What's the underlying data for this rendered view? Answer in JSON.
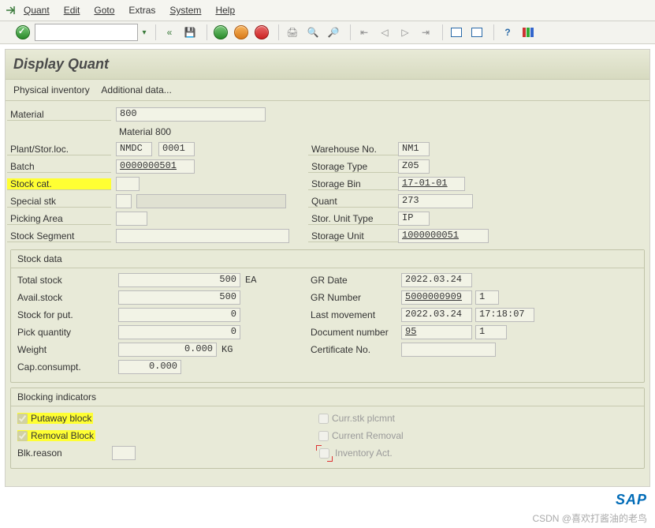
{
  "menu": {
    "quant": "Quant",
    "edit": "Edit",
    "goto": "Goto",
    "extras": "Extras",
    "system": "System",
    "help": "Help"
  },
  "title": "Display Quant",
  "subtoolbar": {
    "phys": "Physical inventory",
    "addl": "Additional data..."
  },
  "header": {
    "material_lbl": "Material",
    "material": "800",
    "material_desc": "Material 800",
    "plant_lbl": "Plant/Stor.loc.",
    "plant": "NMDC",
    "sloc": "0001",
    "batch_lbl": "Batch",
    "batch": "0000000501",
    "stockcat_lbl": "Stock cat.",
    "stockcat": "",
    "special_lbl": "Special stk",
    "special": "",
    "special2": "",
    "pick_lbl": "Picking Area",
    "pick": "",
    "seg_lbl": "Stock Segment",
    "seg": "",
    "whs_lbl": "Warehouse No.",
    "whs": "NM1",
    "styp_lbl": "Storage Type",
    "styp": "Z05",
    "sbin_lbl": "Storage Bin",
    "sbin": "17-01-01",
    "quant_lbl": "Quant",
    "quant": "273",
    "sutype_lbl": "Stor. Unit Type",
    "sutype": "IP",
    "sunit_lbl": "Storage Unit",
    "sunit": "1000000051"
  },
  "stockdata": {
    "title": "Stock data",
    "total_lbl": "Total stock",
    "total": "500",
    "total_u": "EA",
    "avail_lbl": "Avail.stock",
    "avail": "500",
    "forput_lbl": "Stock for put.",
    "forput": "0",
    "pickq_lbl": "Pick quantity",
    "pickq": "0",
    "weight_lbl": "Weight",
    "weight": "0.000",
    "weight_u": "KG",
    "cap_lbl": "Cap.consumpt.",
    "cap": "0.000",
    "grdate_lbl": "GR Date",
    "grdate": "2022.03.24",
    "grnum_lbl": "GR Number",
    "grnum": "5000000909",
    "grnum_it": "1",
    "lastmv_lbl": "Last movement",
    "lastmv_d": "2022.03.24",
    "lastmv_t": "17:18:07",
    "doc_lbl": "Document number",
    "doc": "95",
    "doc_it": "1",
    "cert_lbl": "Certificate No.",
    "cert": ""
  },
  "block": {
    "title": "Blocking indicators",
    "put_lbl": "Putaway block",
    "rem_lbl": "Removal Block",
    "blk_lbl": "Blk.reason",
    "blk": "",
    "cur_lbl": "Curr.stk plcmnt",
    "crm_lbl": "Current Removal",
    "inv_lbl": "Inventory Act."
  },
  "watermark": "CSDN @喜欢打酱油的老鸟"
}
